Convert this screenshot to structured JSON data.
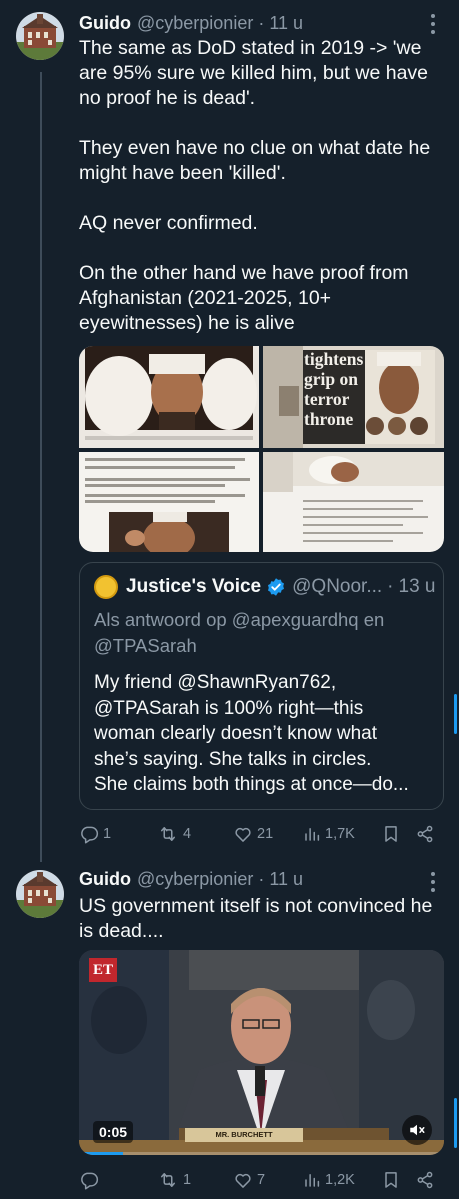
{
  "tweets": [
    {
      "author": {
        "name": "Guido",
        "handle": "@cyberpionier",
        "time": "11 u"
      },
      "text": "The same as DoD stated in 2019 -> 'we\nare 95% sure we killed him, but we have\nno proof he is dead'.\n\nThey even have no clue on what date he\nmight have been 'killed'.\n\nAQ never confirmed.\n\nOn the other hand we have proof from\nAfghanistan (2021-2025, 10+\neyewitnesses) he is alive",
      "media_text": {
        "banner": "tightens\ngrip on\nterror\nthrone"
      },
      "quote": {
        "name": "Justice's Voice",
        "handle": "@QNoor...",
        "time": "13 u",
        "reply_to": "Als antwoord op @apexguardhq en @TPASarah",
        "text": "My friend @ShawnRyan762,\n@TPASarah is 100% right—this\nwoman clearly doesn’t know what\nshe’s saying. She talks in circles.\nShe claims both things at once—do..."
      },
      "stats": {
        "replies": "1",
        "retweets": "4",
        "likes": "21",
        "views": "1,7K"
      }
    },
    {
      "author": {
        "name": "Guido",
        "handle": "@cyberpionier",
        "time": "11 u"
      },
      "text": "US government itself is not convinced he\nis dead....",
      "video": {
        "time": "0:05",
        "logo": "ET",
        "nameplate": "MR. BURCHETT",
        "progress": 0.12
      },
      "stats": {
        "replies": "",
        "retweets": "1",
        "likes": "7",
        "views": "1,2K"
      }
    }
  ],
  "colors": {
    "background": "#15202b",
    "text": "#f7f9f9",
    "muted": "#8b98a5",
    "accent": "#1d9bf0",
    "border": "#38444d"
  },
  "icons": [
    "more-icon",
    "reply-icon",
    "retweet-icon",
    "like-icon",
    "views-icon",
    "bookmark-icon",
    "share-icon",
    "verified-icon",
    "mute-icon"
  ]
}
